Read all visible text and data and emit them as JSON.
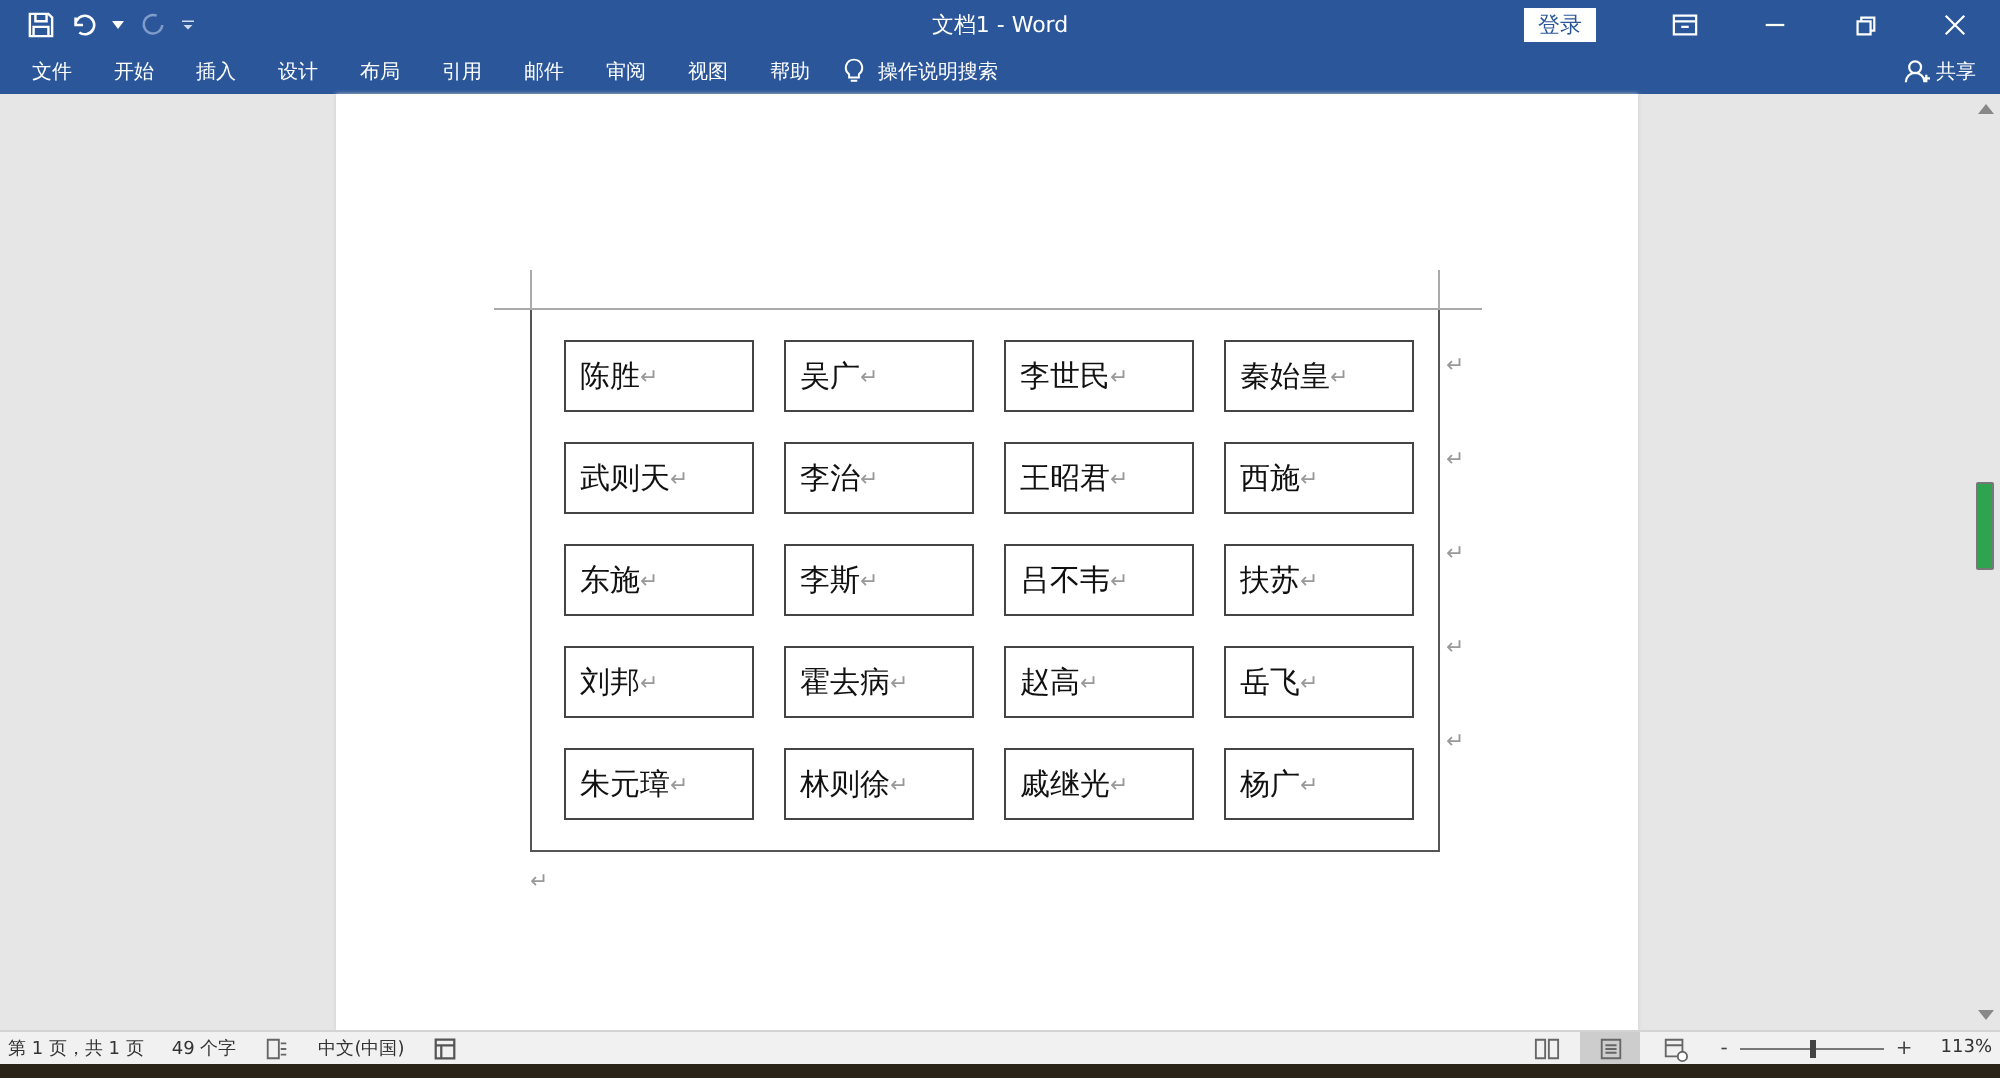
{
  "window": {
    "title": "文档1 - Word",
    "signin": "登录"
  },
  "ribbon": {
    "tabs": [
      {
        "label": "文件",
        "selected": false
      },
      {
        "label": "开始",
        "selected": false
      },
      {
        "label": "插入",
        "selected": false
      },
      {
        "label": "设计",
        "selected": false
      },
      {
        "label": "布局",
        "selected": false
      },
      {
        "label": "引用",
        "selected": false
      },
      {
        "label": "邮件",
        "selected": false
      },
      {
        "label": "审阅",
        "selected": false
      },
      {
        "label": "视图",
        "selected": false
      },
      {
        "label": "帮助",
        "selected": false
      }
    ],
    "search": "操作说明搜索",
    "share": "共享"
  },
  "table": {
    "rows": [
      {
        "cells": [
          {
            "text": "陈胜",
            "mark": "↵"
          },
          {
            "text": "吴广",
            "mark": "↵"
          },
          {
            "text": "李世民",
            "mark": "↵"
          },
          {
            "text": "秦始皇",
            "mark": "↵"
          }
        ],
        "end_mark": "↵"
      },
      {
        "cells": [
          {
            "text": "武则天",
            "mark": "↵"
          },
          {
            "text": "李治",
            "mark": "↵"
          },
          {
            "text": "王昭君",
            "mark": "↵"
          },
          {
            "text": "西施",
            "mark": "↵"
          }
        ],
        "end_mark": "↵"
      },
      {
        "cells": [
          {
            "text": "东施",
            "mark": "↵"
          },
          {
            "text": "李斯",
            "mark": "↵"
          },
          {
            "text": "吕不韦",
            "mark": "↵"
          },
          {
            "text": "扶苏",
            "mark": "↵"
          }
        ],
        "end_mark": "↵"
      },
      {
        "cells": [
          {
            "text": "刘邦",
            "mark": "↵"
          },
          {
            "text": "霍去病",
            "mark": "↵"
          },
          {
            "text": "赵高",
            "mark": "↵"
          },
          {
            "text": "岳飞",
            "mark": "↵"
          }
        ],
        "end_mark": "↵"
      },
      {
        "cells": [
          {
            "text": "朱元璋",
            "mark": "↵"
          },
          {
            "text": "林则徐",
            "mark": "↵"
          },
          {
            "text": "戚继光",
            "mark": "↵"
          },
          {
            "text": "杨广",
            "mark": "↵"
          }
        ],
        "end_mark": "↵"
      }
    ]
  },
  "paragraph_mark": "↵",
  "status_bar": {
    "page": "第 1 页，共 1 页",
    "words": "49 个字",
    "language": "中文(中国)",
    "views": [
      {
        "kind": "read",
        "selected": false
      },
      {
        "kind": "print",
        "selected": true
      },
      {
        "kind": "web",
        "selected": false
      }
    ],
    "zoom_minus": "-",
    "zoom_plus": "+",
    "zoom": {
      "level": 0.5
    },
    "zoom_text": "113%"
  }
}
